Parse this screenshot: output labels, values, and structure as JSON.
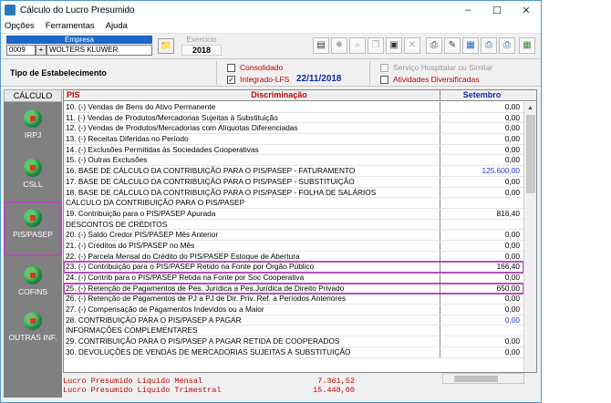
{
  "window": {
    "title": "Cálculo do Lucro Presumido",
    "controls": [
      "–",
      "☐",
      "✕"
    ]
  },
  "menu": [
    "Opções",
    "Ferramentas",
    "Ajuda"
  ],
  "empresa": {
    "header": "Empresa",
    "code": "0009",
    "name": "WOLTERS KLUWER"
  },
  "exercicio": {
    "label": "Exercício",
    "value": "2018"
  },
  "toolbar_icons": [
    "new-doc-icon",
    "star-icon",
    "search-icon",
    "copy-icon",
    "save-icon",
    "delete-icon",
    "print-icon",
    "sign-icon",
    "calculator-icon",
    "printer-preview-icon",
    "printer-settings-icon",
    "report-icon"
  ],
  "tipo": {
    "label": "Tipo de Estabelecimento",
    "consolidado": "Consolidado",
    "integrado": "Integrado-LFS",
    "date": "22/11/2018",
    "servico": "Serviço Hospitalar ou Similar",
    "atividades": "Atividades Diversificadas"
  },
  "sidebar": {
    "header": "CÁLCULO",
    "items": [
      "IRPJ",
      "CSLL",
      "PIS/PASEP",
      "COFINS",
      "OUTRAS INF."
    ]
  },
  "grid": {
    "col_pis": "PIS",
    "col_disc": "Discriminação",
    "col_month": "Setembro",
    "rows": [
      {
        "d": "10. (-) Vendas de Bens do Ativo Permanente",
        "v": "0,00"
      },
      {
        "d": "11. (-) Vendas de Produtos/Mercadorias Sujeitas à Substituição",
        "v": "0,00"
      },
      {
        "d": "12. (-) Vendas de Produtos/Mercadorias com Alíquotas Diferenciadas",
        "v": "0,00"
      },
      {
        "d": "13. (-) Receitas Diferidas no Período",
        "v": "0,00"
      },
      {
        "d": "14. (-) Exclusões Permitidas às Sociedades Cooperativas",
        "v": "0,00"
      },
      {
        "d": "15. (-) Outras Exclusões",
        "v": "0,00"
      },
      {
        "d": "16. BASE DE CÁLCULO DA CONTRIBUIÇÃO PARA O PIS/PASEP - FATURAMENTO",
        "v": "125.600,00"
      },
      {
        "d": "17. BASE DE CÁLCULO DA CONTRIBUIÇÃO PARA O PIS/PASEP - SUBSTITUIÇÃO",
        "v": "0,00"
      },
      {
        "d": "18. BASE DE CÁLCULO DA CONTRIBUIÇÃO PARA O PIS/PASEP - FOLHA DE SALÁRIOS",
        "v": "0,00"
      },
      {
        "d": "CÁLCULO DA CONTRIBUIÇÃO PARA O PIS/PASEP",
        "v": ""
      },
      {
        "d": "19. Contribuição para o PIS/PASEP Apurada",
        "v": "816,40"
      },
      {
        "d": "DESCONTOS DE CRÉDITOS",
        "v": ""
      },
      {
        "d": "20. (-) Saldo Credor PIS/PASEP Mês Anterior",
        "v": "0,00"
      },
      {
        "d": "21. (-) Créditos do PIS/PASEP no Mês",
        "v": "0,00"
      },
      {
        "d": "22. (-) Parcela Mensal do Crédito do PIS/PASEP Estoque de Abertura",
        "v": "0,00"
      },
      {
        "d": "23. (-) Contribuição para o PIS/PASEP Retido na Fonte por Órgão Público",
        "v": "166,40"
      },
      {
        "d": "24. (-) Contrib para o PIS/PASEP Retida na Fonte por Soc Cooperativa",
        "v": "0,00"
      },
      {
        "d": "25. (-) Retenção de Pagamentos de Pes. Jurídica a Pes.Jurídica de Direito Privado",
        "v": "650,00"
      },
      {
        "d": "26. (-) Retenção de Pagamentos de PJ a PJ de Dir. Priv. Ref. a Períodos Anteriores",
        "v": "0,00"
      },
      {
        "d": "27. (-) Compensação de Pagamentos Indevidos ou a Maior",
        "v": "0,00"
      },
      {
        "d": "28. CONTRIBUIÇÃO PARA O PIS/PASEP A PAGAR",
        "v": "0,00"
      },
      {
        "d": "INFORMAÇÕES COMPLEMENTARES",
        "v": ""
      },
      {
        "d": "29. CONTRIBUIÇÃO PARA O PIS/PASEP A PAGAR RETIDA DE COOPERADOS",
        "v": "0,00"
      },
      {
        "d": "30. DEVOLUÇÕES DE VENDAS DE MERCADORIAS SUJEITAS À SUBSTITUIÇÃO",
        "v": "0,00"
      }
    ]
  },
  "footer": {
    "l1": "Lucro Presumido Líquido Mensal",
    "v1": "7.361,52",
    "l2": "Lucro Presumido Líquido Trimestral",
    "v2": "15.448,00"
  },
  "colors": {
    "accent_red": "#c00000",
    "accent_blue": "#1a3ad0",
    "highlight": "#b050b8",
    "date_blue": "#0a2aa8"
  }
}
